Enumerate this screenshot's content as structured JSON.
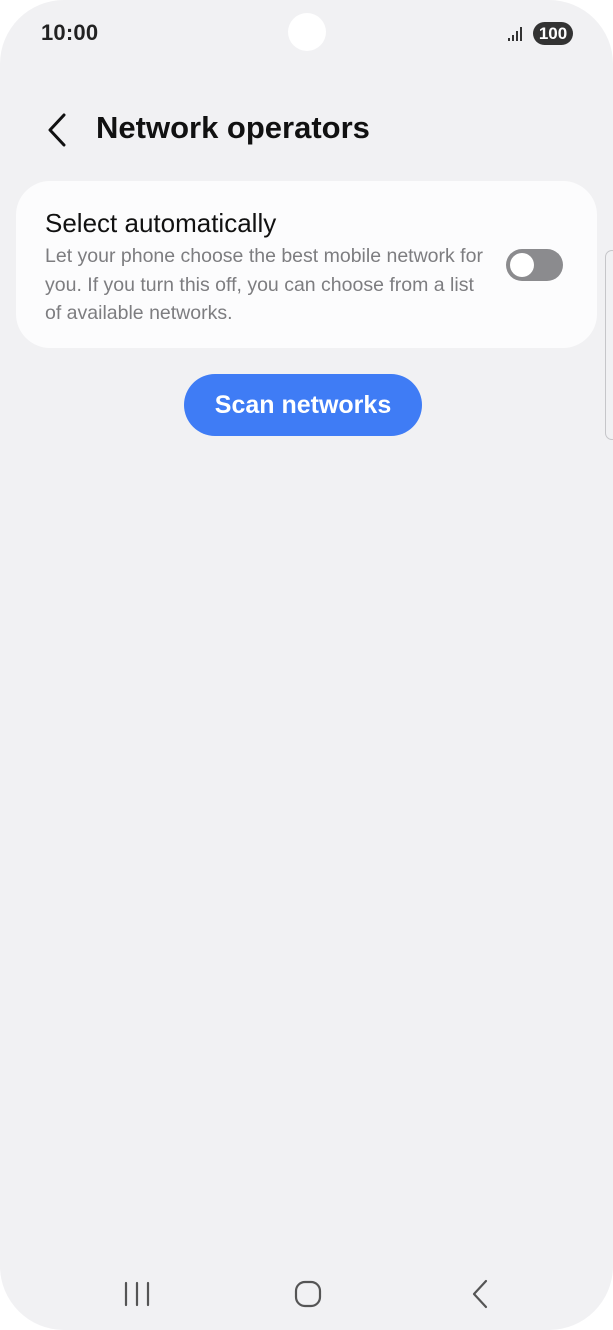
{
  "status_bar": {
    "time": "10:00",
    "battery": "100",
    "icons": [
      "signal-icon",
      "battery-icon"
    ]
  },
  "header": {
    "title": "Network operators",
    "back_icon": "chevron-left-icon"
  },
  "select_automatically": {
    "title": "Select automatically",
    "description": "Let your phone choose the best mobile network for you. If you turn this off, you can choose from a list of available networks.",
    "enabled": false
  },
  "scan_button": {
    "label": "Scan networks"
  },
  "nav_bar": {
    "icons": [
      "recents-icon",
      "home-icon",
      "back-icon"
    ]
  },
  "colors": {
    "background": "#f1f1f3",
    "card": "#fcfcfd",
    "accent": "#3f7cf5",
    "toggle_off": "#8b8b8e",
    "secondary_text": "#7d7d80"
  }
}
